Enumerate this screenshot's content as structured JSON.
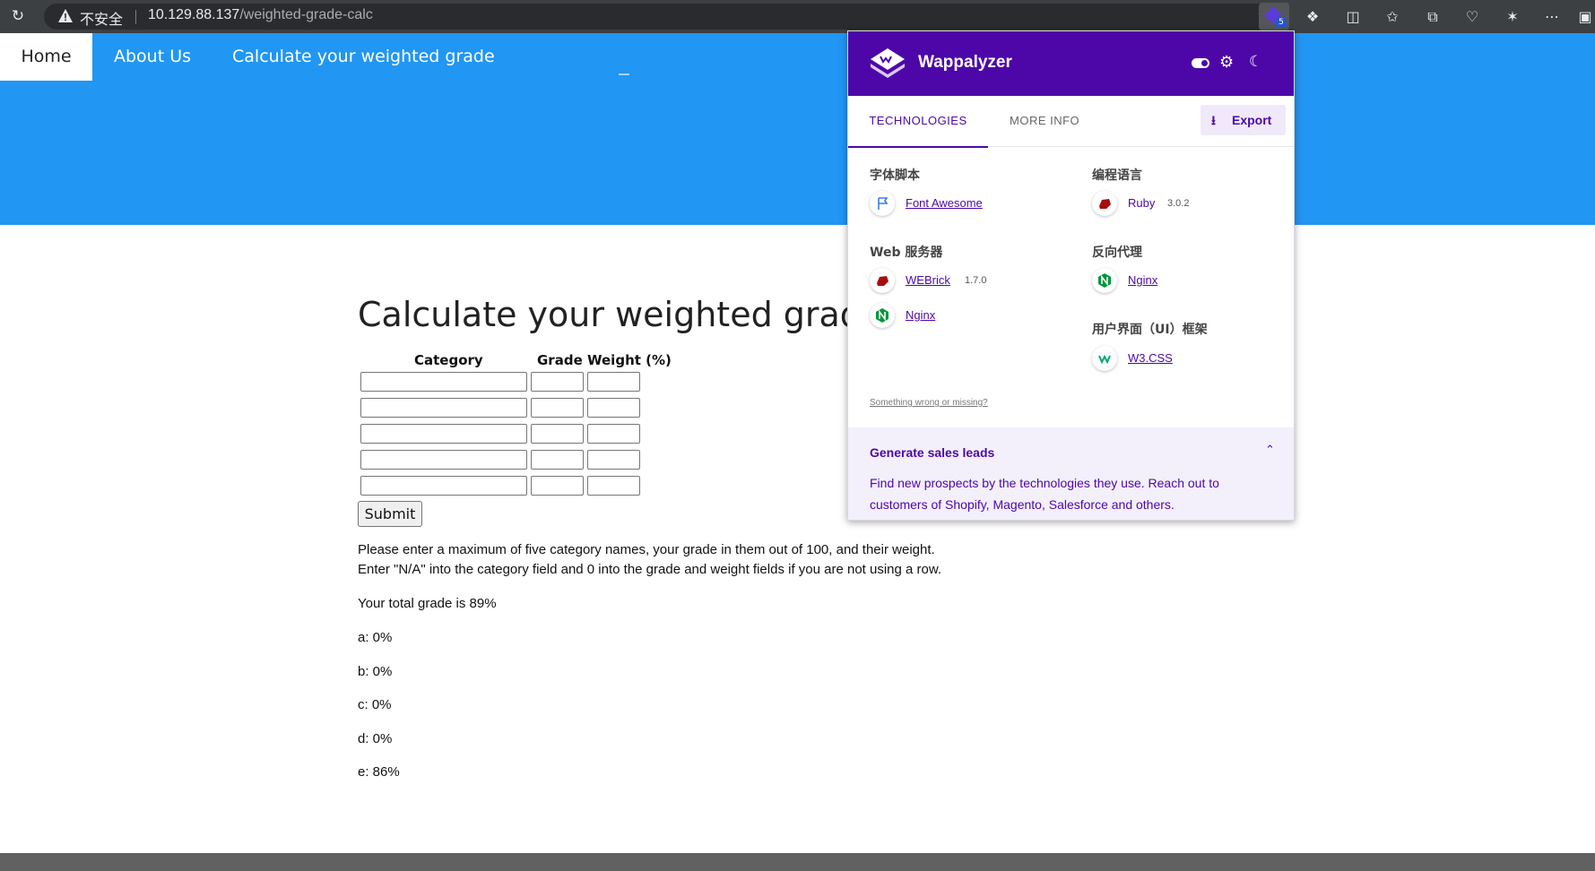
{
  "browser": {
    "insecure_label": "不安全",
    "url_host": "10.129.88.137",
    "url_path": "/weighted-grade-calc",
    "extension_badge": "5"
  },
  "nav": {
    "items": [
      {
        "label": "Home"
      },
      {
        "label": "About Us"
      },
      {
        "label": "Calculate your weighted grade"
      }
    ]
  },
  "main": {
    "title": "Calculate your weighted grade",
    "table": {
      "headers": [
        "Category",
        "Grade",
        "Weight (%)"
      ],
      "rows": [
        {
          "category": "",
          "grade": "",
          "weight": ""
        },
        {
          "category": "",
          "grade": "",
          "weight": ""
        },
        {
          "category": "",
          "grade": "",
          "weight": ""
        },
        {
          "category": "",
          "grade": "",
          "weight": ""
        },
        {
          "category": "",
          "grade": "",
          "weight": ""
        }
      ]
    },
    "submit_label": "Submit",
    "instructions_1": "Please enter a maximum of five category names, your grade in them out of 100, and their weight.",
    "instructions_2": "Enter \"N/A\" into the category field and 0 into the grade and weight fields if you are not using a row.",
    "total_grade": "Your total grade is 89%",
    "results": [
      "a: 0%",
      "b: 0%",
      "c: 0%",
      "d: 0%",
      "e: 86%"
    ]
  },
  "wappalyzer": {
    "title": "Wappalyzer",
    "tabs": [
      "TECHNOLOGIES",
      "MORE INFO"
    ],
    "export_label": "Export",
    "categories": [
      {
        "name": "字体脚本",
        "techs": [
          {
            "name": "Font Awesome",
            "version": ""
          }
        ]
      },
      {
        "name": "编程语言",
        "techs": [
          {
            "name": "Ruby",
            "version": "3.0.2"
          }
        ]
      },
      {
        "name": "Web 服务器",
        "techs": [
          {
            "name": "WEBrick",
            "version": "1.7.0"
          },
          {
            "name": "Nginx",
            "version": ""
          }
        ]
      },
      {
        "name": "反向代理",
        "techs": [
          {
            "name": "Nginx",
            "version": ""
          }
        ]
      },
      {
        "name": "用户界面（UI）框架",
        "techs": [
          {
            "name": "W3.CSS",
            "version": ""
          }
        ]
      }
    ],
    "wrong_link": "Something wrong or missing?",
    "leads_title": "Generate sales leads",
    "leads_body": "Find new prospects by the technologies they use. Reach out to customers of Shopify, Magento, Salesforce and others.",
    "colors": {
      "primary": "#4d07a8",
      "leads_bg": "#f3effb"
    }
  },
  "colors": {
    "nav_blue": "#2196f3",
    "chrome_dark": "#3c4043",
    "footer_grey": "#616161"
  }
}
